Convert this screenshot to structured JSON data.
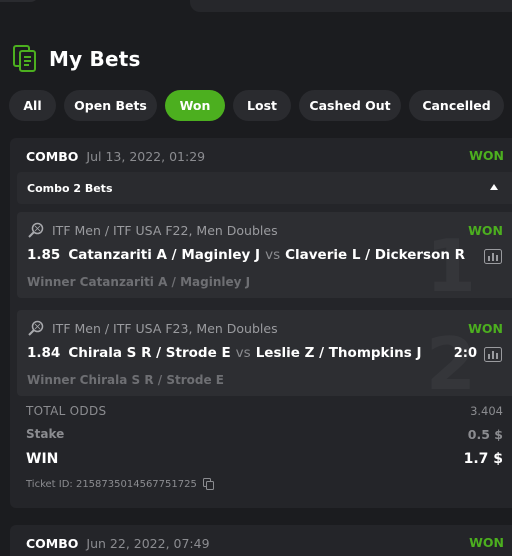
{
  "page": {
    "title": "My Bets"
  },
  "filters": [
    {
      "label": "All",
      "active": false
    },
    {
      "label": "Open Bets",
      "active": false
    },
    {
      "label": "Won",
      "active": true
    },
    {
      "label": "Lost",
      "active": false
    },
    {
      "label": "Cashed Out",
      "active": false
    },
    {
      "label": "Cancelled",
      "active": false
    }
  ],
  "colors": {
    "accent": "#4caf1f",
    "background": "#1b1c1f",
    "card": "#242529",
    "muted": "#8b8c90"
  },
  "bets": [
    {
      "type": "COMBO",
      "date": "Jul 13, 2022, 01:29",
      "status": "WON",
      "group_label": "Combo 2 Bets",
      "legs": [
        {
          "index": "1",
          "sport_icon": "tennis-racket-icon",
          "tournament": "ITF Men / ITF USA F22, Men Doubles",
          "status": "WON",
          "odds": "1.85",
          "home": "Catanzariti A / Maginley J",
          "vs": "vs",
          "away": "Claverie L / Dickerson R",
          "score": "",
          "pick": "Winner Catanzariti A / Maginley J"
        },
        {
          "index": "2",
          "sport_icon": "tennis-racket-icon",
          "tournament": "ITF Men / ITF USA F23, Men Doubles",
          "status": "WON",
          "odds": "1.84",
          "home": "Chirala S R / Strode E",
          "vs": "vs",
          "away": "Leslie Z / Thompkins J",
          "score": "2:0",
          "pick": "Winner Chirala S R / Strode E"
        }
      ],
      "total_odds_label": "TOTAL ODDS",
      "total_odds": "3.404",
      "stake_label": "Stake",
      "stake": "0.5 $",
      "win_label": "WIN",
      "win": "1.7 $",
      "ticket_label": "Ticket ID: 2158735014567751725"
    },
    {
      "type": "COMBO",
      "date": "Jun 22, 2022, 07:49",
      "status": "WON"
    }
  ]
}
